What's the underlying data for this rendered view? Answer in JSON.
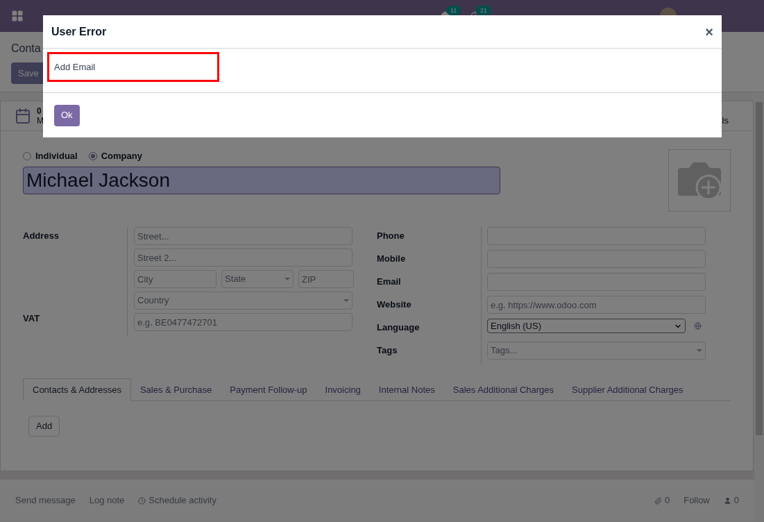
{
  "navbar": {
    "badges": [
      {
        "count": "11"
      },
      {
        "count": "21"
      }
    ]
  },
  "control_panel": {
    "breadcrumb": "Conta",
    "save": "Save"
  },
  "smart_buttons": {
    "count": "0",
    "label": "M",
    "right_label": "ls"
  },
  "form": {
    "company_type": [
      {
        "label": "Individual",
        "selected": false
      },
      {
        "label": "Company",
        "selected": true
      }
    ],
    "name": "Michael Jackson",
    "left": [
      {
        "label": "Address",
        "fields": [
          [
            {
              "kind": "input",
              "placeholder": "Street..."
            }
          ],
          [
            {
              "kind": "input",
              "placeholder": "Street 2..."
            }
          ],
          [
            {
              "kind": "input",
              "placeholder": "City"
            },
            {
              "kind": "select",
              "placeholder": "State"
            },
            {
              "kind": "input",
              "placeholder": "ZIP"
            }
          ],
          [
            {
              "kind": "select",
              "placeholder": "Country"
            }
          ]
        ]
      },
      {
        "label": "VAT",
        "fields": [
          [
            {
              "kind": "input",
              "placeholder": "e.g. BE0477472701"
            }
          ]
        ]
      }
    ],
    "right": [
      {
        "label": "Phone",
        "kind": "input"
      },
      {
        "label": "Mobile",
        "kind": "input"
      },
      {
        "label": "Email",
        "kind": "input"
      },
      {
        "label": "Website",
        "kind": "input",
        "placeholder": "e.g. https://www.odoo.com"
      },
      {
        "label": "Language",
        "kind": "language",
        "value": "English (US)"
      },
      {
        "label": "Tags",
        "kind": "tags",
        "placeholder": "Tags..."
      }
    ],
    "tabs": [
      {
        "label": "Contacts & Addresses",
        "selected": true
      },
      {
        "label": "Sales & Purchase",
        "selected": false
      },
      {
        "label": "Payment Follow-up",
        "selected": false
      },
      {
        "label": "Invoicing",
        "selected": false
      },
      {
        "label": "Internal Notes",
        "selected": false
      },
      {
        "label": "Sales Additional Charges",
        "selected": false
      },
      {
        "label": "Supplier Additional Charges",
        "selected": false
      }
    ],
    "add": "Add"
  },
  "chatter": {
    "send": "Send message",
    "log": "Log note",
    "schedule": "Schedule activity",
    "attachments": "0",
    "follow": "Follow",
    "followers": "0"
  },
  "dialog": {
    "title": "User Error",
    "close": "×",
    "message": "Add Email",
    "ok": "Ok"
  }
}
